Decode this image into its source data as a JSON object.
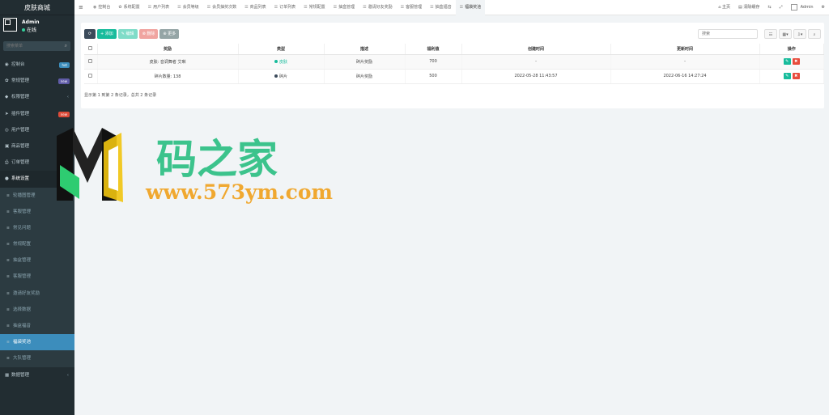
{
  "brand": "皮肤商城",
  "user": {
    "name": "Admin",
    "status": "在线"
  },
  "search": {
    "placeholder": "搜索菜单"
  },
  "menu": [
    {
      "name": "dashboard",
      "icon": "◉",
      "label": "控制台",
      "badge": "hot",
      "badge_color": "#3c8dbc"
    },
    {
      "name": "general",
      "icon": "✿",
      "label": "常规管理",
      "badge": "new",
      "badge_color": "#605ca8"
    },
    {
      "name": "auth",
      "icon": "◆",
      "label": "权限管理",
      "chevron": "‹"
    },
    {
      "name": "addon",
      "icon": "➤",
      "label": "插件管理",
      "badge": "new",
      "badge_color": "#dd4b39"
    },
    {
      "name": "member",
      "icon": "◎",
      "label": "用户管理"
    },
    {
      "name": "goods",
      "icon": "▣",
      "label": "商品管理"
    },
    {
      "name": "order",
      "icon": "⎙",
      "label": "订单管理"
    },
    {
      "name": "system",
      "icon": "●",
      "label": "系统设置",
      "open": true
    }
  ],
  "submenu": [
    {
      "label": "轮播图管理"
    },
    {
      "label": "客服管理"
    },
    {
      "label": "常见问题"
    },
    {
      "label": "常规配置"
    },
    {
      "label": "抽盒管理"
    },
    {
      "label": "客服管理"
    },
    {
      "label": "邀请好友奖励"
    },
    {
      "label": "选择数据"
    },
    {
      "label": "抽盒福音"
    },
    {
      "label": "福袋奖池",
      "active": true
    },
    {
      "label": "大队管理"
    }
  ],
  "menu_bottom": {
    "icon": "▦",
    "label": "数据管理",
    "chevron": "‹"
  },
  "tabs": [
    {
      "icon": "◉",
      "label": "控制台"
    },
    {
      "icon": "✿",
      "label": "系统配置"
    },
    {
      "icon": "☰",
      "label": "用户列表"
    },
    {
      "icon": "☰",
      "label": "会员等级"
    },
    {
      "icon": "☰",
      "label": "会员抽奖次数"
    },
    {
      "icon": "☰",
      "label": "商品列表"
    },
    {
      "icon": "☰",
      "label": "订单列表"
    },
    {
      "icon": "☰",
      "label": "常规配置"
    },
    {
      "icon": "☰",
      "label": "抽盒管理"
    },
    {
      "icon": "☰",
      "label": "邀请好友奖励"
    },
    {
      "icon": "☰",
      "label": "客服管理"
    },
    {
      "icon": "☰",
      "label": "抽盒福音"
    },
    {
      "icon": "☰",
      "label": "福袋奖池",
      "active": true
    }
  ],
  "topright": {
    "home": "主页",
    "clear": "清除缓存",
    "admin": "Admin"
  },
  "toolbar": {
    "refresh": "⟳",
    "add": "+ 添加",
    "edit": "✎ 编辑",
    "delete": "⊗ 删除",
    "more": "⊕ 更多"
  },
  "table_search": {
    "placeholder": "搜索"
  },
  "table": {
    "headers": [
      "奖励",
      "类型",
      "描述",
      "福利值",
      "创建时间",
      "更新时间",
      "操作"
    ],
    "rows": [
      {
        "reward": "皮肤: 音调舞者 艾琳",
        "type": "皮肤",
        "type_color": "#18bc9c",
        "desc": "碎片奖励",
        "value": "700",
        "created": "-",
        "updated": "-"
      },
      {
        "reward": "碎片数量: 138",
        "type": "碎片",
        "type_color": "#3b4a5a",
        "desc": "碎片奖励",
        "value": "500",
        "created": "2022-05-28 11:43:57",
        "updated": "2022-06-16 14:27:24"
      }
    ]
  },
  "pagination": "显示第 1 到第 2 条记录，总共 2 条记录",
  "watermark": {
    "title": "码之家",
    "url": "www.573ym.com"
  }
}
